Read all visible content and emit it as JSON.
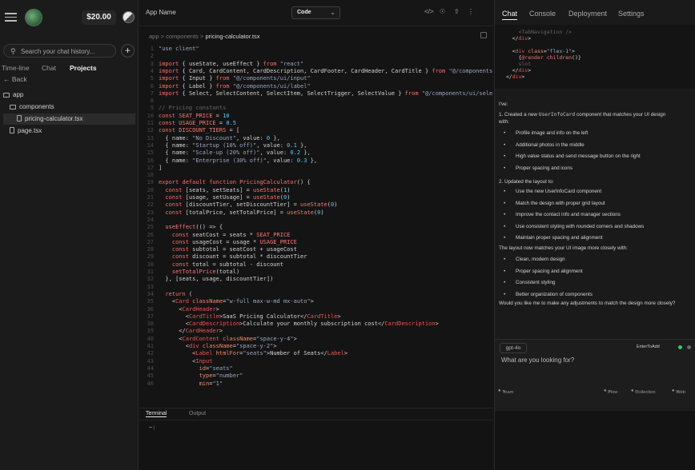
{
  "sidebar": {
    "balance": "$20.00",
    "search_placeholder": "Search your chat history...",
    "tabs": [
      "Time-line",
      "Chat",
      "Projects"
    ],
    "active_tab": "Projects",
    "back_label": "← Back",
    "tree": [
      {
        "label": "app",
        "depth": 0,
        "kind": "folder"
      },
      {
        "label": "components",
        "depth": 1,
        "kind": "folder"
      },
      {
        "label": "pricing-calculator.tsx",
        "depth": 2,
        "kind": "file",
        "selected": true
      },
      {
        "label": "page.tsx",
        "depth": 1,
        "kind": "file"
      }
    ]
  },
  "editor": {
    "app_name": "App Name",
    "mode_select": "Code",
    "breadcrumb": [
      "app",
      "components",
      "pricing-calculator.tsx"
    ],
    "bottom_tabs": [
      "Terminal",
      "Output"
    ],
    "terminal_prompt": "~:",
    "code_lines": [
      [
        [
          "str",
          "\"use client\""
        ]
      ],
      [],
      [
        [
          "kw",
          "import"
        ],
        [
          "pl",
          " { useState, useEffect } "
        ],
        [
          "kw",
          "from"
        ],
        [
          "str",
          " \"react\""
        ]
      ],
      [
        [
          "kw",
          "import"
        ],
        [
          "pl",
          " { Card, CardContent, CardDescription, CardFooter, CardHeader, CardTitle } "
        ],
        [
          "kw",
          "from"
        ],
        [
          "str",
          " \"@/components"
        ]
      ],
      [
        [
          "kw",
          "import"
        ],
        [
          "pl",
          " { Input } "
        ],
        [
          "kw",
          "from"
        ],
        [
          "str",
          " \"@/components/ui/input\""
        ]
      ],
      [
        [
          "kw",
          "import"
        ],
        [
          "pl",
          " { Label } "
        ],
        [
          "kw",
          "from"
        ],
        [
          "str",
          " \"@/components/ui/label\""
        ]
      ],
      [
        [
          "kw",
          "import"
        ],
        [
          "pl",
          " { Select, SelectContent, SelectItem, SelectTrigger, SelectValue } "
        ],
        [
          "kw",
          "from"
        ],
        [
          "str",
          " \"@/components/ui/sele"
        ]
      ],
      [],
      [
        [
          "cmt",
          "// Pricing constants"
        ]
      ],
      [
        [
          "kw",
          "const"
        ],
        [
          "fn",
          " SEAT_PRICE"
        ],
        [
          "pl",
          " = "
        ],
        [
          "num",
          "10"
        ]
      ],
      [
        [
          "kw",
          "const"
        ],
        [
          "fn",
          " USAGE_PRICE"
        ],
        [
          "pl",
          " = "
        ],
        [
          "num",
          "0.5"
        ]
      ],
      [
        [
          "kw",
          "const"
        ],
        [
          "fn",
          " DISCOUNT_TIERS"
        ],
        [
          "pl",
          " = ["
        ]
      ],
      [
        [
          "pl",
          "  { name: "
        ],
        [
          "str",
          "\"No Discount\""
        ],
        [
          "pl",
          ", value: "
        ],
        [
          "num",
          "0"
        ],
        [
          "pl",
          " },"
        ]
      ],
      [
        [
          "pl",
          "  { name: "
        ],
        [
          "str",
          "\"Startup (10% off)\""
        ],
        [
          "pl",
          ", value: "
        ],
        [
          "num",
          "0.1"
        ],
        [
          "pl",
          " },"
        ]
      ],
      [
        [
          "pl",
          "  { name: "
        ],
        [
          "str",
          "\"Scale-up (20% off)\""
        ],
        [
          "pl",
          ", value: "
        ],
        [
          "num",
          "0.2"
        ],
        [
          "pl",
          " },"
        ]
      ],
      [
        [
          "pl",
          "  { name: "
        ],
        [
          "str",
          "\"Enterprise (30% off)\""
        ],
        [
          "pl",
          ", value: "
        ],
        [
          "num",
          "0.3"
        ],
        [
          "pl",
          " },"
        ]
      ],
      [
        [
          "pl",
          "]"
        ]
      ],
      [],
      [
        [
          "kw",
          "export default function"
        ],
        [
          "fn",
          " PricingCalculator"
        ],
        [
          "pl",
          "() {"
        ]
      ],
      [
        [
          "kw",
          "  const"
        ],
        [
          "pl",
          " [seats, setSeats] = "
        ],
        [
          "fn",
          "useState"
        ],
        [
          "pl",
          "("
        ],
        [
          "num",
          "1"
        ],
        [
          "pl",
          ")"
        ]
      ],
      [
        [
          "kw",
          "  const"
        ],
        [
          "pl",
          " [usage, setUsage] = "
        ],
        [
          "fn",
          "useState"
        ],
        [
          "pl",
          "("
        ],
        [
          "num",
          "0"
        ],
        [
          "pl",
          ")"
        ]
      ],
      [
        [
          "kw",
          "  const"
        ],
        [
          "pl",
          " [discountTier, setDiscountTier] = "
        ],
        [
          "fn",
          "useState"
        ],
        [
          "pl",
          "("
        ],
        [
          "num",
          "0"
        ],
        [
          "pl",
          ")"
        ]
      ],
      [
        [
          "kw",
          "  const"
        ],
        [
          "pl",
          " [totalPrice, setTotalPrice] = "
        ],
        [
          "fn",
          "useState"
        ],
        [
          "pl",
          "("
        ],
        [
          "num",
          "0"
        ],
        [
          "pl",
          ")"
        ]
      ],
      [],
      [
        [
          "fn",
          "  useEffect"
        ],
        [
          "pl",
          "(() => {"
        ]
      ],
      [
        [
          "kw",
          "    const"
        ],
        [
          "pl",
          " seatCost = seats * "
        ],
        [
          "fn",
          "SEAT_PRICE"
        ]
      ],
      [
        [
          "kw",
          "    const"
        ],
        [
          "pl",
          " usageCost = usage * "
        ],
        [
          "fn",
          "USAGE_PRICE"
        ]
      ],
      [
        [
          "kw",
          "    const"
        ],
        [
          "pl",
          " subtotal = seatCost + usageCost"
        ]
      ],
      [
        [
          "kw",
          "    const"
        ],
        [
          "pl",
          " discount = subtotal * discountTier"
        ]
      ],
      [
        [
          "kw",
          "    const"
        ],
        [
          "pl",
          " total = subtotal - discount"
        ]
      ],
      [
        [
          "fn",
          "    setTotalPrice"
        ],
        [
          "pl",
          "(total)"
        ]
      ],
      [
        [
          "pl",
          "  }, [seats, usage, discountTier])"
        ]
      ],
      [],
      [
        [
          "kw",
          "  return"
        ],
        [
          "pl",
          " ("
        ]
      ],
      [
        [
          "pl",
          "    <"
        ],
        [
          "tag",
          "Card"
        ],
        [
          "attr",
          " className"
        ],
        [
          "pl",
          "="
        ],
        [
          "str",
          "\"w-full max-w-md mx-auto\""
        ],
        [
          "pl",
          ">"
        ]
      ],
      [
        [
          "pl",
          "      <"
        ],
        [
          "tag",
          "CardHeader"
        ],
        [
          "pl",
          ">"
        ]
      ],
      [
        [
          "pl",
          "        <"
        ],
        [
          "tag",
          "CardTitle"
        ],
        [
          "pl",
          ">SaaS Pricing Calculator</"
        ],
        [
          "tag",
          "CardTitle"
        ],
        [
          "pl",
          ">"
        ]
      ],
      [
        [
          "pl",
          "        <"
        ],
        [
          "tag",
          "CardDescription"
        ],
        [
          "pl",
          ">Calculate your monthly subscription cost</"
        ],
        [
          "tag",
          "CardDescription"
        ],
        [
          "pl",
          ">"
        ]
      ],
      [
        [
          "pl",
          "      </"
        ],
        [
          "tag",
          "CardHeader"
        ],
        [
          "pl",
          ">"
        ]
      ],
      [
        [
          "pl",
          "      <"
        ],
        [
          "tag",
          "CardContent"
        ],
        [
          "attr",
          " className"
        ],
        [
          "pl",
          "="
        ],
        [
          "str",
          "\"space-y-4\""
        ],
        [
          "pl",
          ">"
        ]
      ],
      [
        [
          "pl",
          "        <"
        ],
        [
          "tag",
          "div"
        ],
        [
          "attr",
          " className"
        ],
        [
          "pl",
          "="
        ],
        [
          "str",
          "\"space-y-2\""
        ],
        [
          "pl",
          ">"
        ]
      ],
      [
        [
          "pl",
          "          <"
        ],
        [
          "tag",
          "Label"
        ],
        [
          "attr",
          " htmlFor"
        ],
        [
          "pl",
          "="
        ],
        [
          "str",
          "\"seats\""
        ],
        [
          "pl",
          ">Number of Seats</"
        ],
        [
          "tag",
          "Label"
        ],
        [
          "pl",
          ">"
        ]
      ],
      [
        [
          "pl",
          "          <"
        ],
        [
          "tag",
          "Input"
        ]
      ],
      [
        [
          "attr",
          "            id"
        ],
        [
          "pl",
          "="
        ],
        [
          "str",
          "\"seats\""
        ]
      ],
      [
        [
          "attr",
          "            type"
        ],
        [
          "pl",
          "="
        ],
        [
          "str",
          "\"number\""
        ]
      ],
      [
        [
          "attr",
          "            min"
        ],
        [
          "pl",
          "="
        ],
        [
          "str",
          "\"1\""
        ]
      ]
    ]
  },
  "chat": {
    "tabs": [
      "Chat",
      "Console",
      "Deployment",
      "Settings"
    ],
    "active_tab": "Chat",
    "snippet_lines": [
      [
        [
          "cmt",
          "      <TabNavigation />"
        ]
      ],
      [
        [
          "pl",
          "    </"
        ],
        [
          "tag",
          "div"
        ],
        [
          "pl",
          ">"
        ]
      ],
      [],
      [
        [
          "pl",
          "    <"
        ],
        [
          "tag",
          "div"
        ],
        [
          "attr",
          " class"
        ],
        [
          "pl",
          "="
        ],
        [
          "str",
          "\"flex-1\""
        ],
        [
          "pl",
          ">"
        ]
      ],
      [
        [
          "pl",
          "      {"
        ],
        [
          "kw",
          "@render"
        ],
        [
          "fn",
          " children"
        ],
        [
          "pl",
          "()}"
        ]
      ],
      [
        [
          "cmt",
          "      slot"
        ]
      ],
      [
        [
          "pl",
          "    </"
        ],
        [
          "tag",
          "div"
        ],
        [
          "pl",
          ">"
        ]
      ],
      [
        [
          "pl",
          "  </"
        ],
        [
          "tag",
          "div"
        ],
        [
          "pl",
          ">"
        ]
      ]
    ],
    "intro": "I've:",
    "step1_pre": "1. Created a new ",
    "step1_code": "UserInfoCard",
    "step1_post": " component that matches your UI design",
    "step1_cont": "with:",
    "step1_bullets": [
      "Profile image and info on the left",
      "Additional photos in the middle",
      "High value status and send message button on the right",
      "Proper spacing and icons"
    ],
    "step2": "2. Updated the layout to:",
    "step2_bullets": [
      "Use the new UserInfoCard component",
      "Match the design with proper grid layout",
      "Improve the contact info and manager sections",
      "Use consistent styling with rounded corners and shadows",
      "Maintain proper spacing and alignment"
    ],
    "summary": "The layout now matches your UI image more closely with:",
    "summary_bullets": [
      "Clean, modern design",
      "Proper spacing and alignment",
      "Consistent styling",
      "Better organization of components"
    ],
    "question": "Would you like me to make any adjustments to match the design more closely?",
    "model": "gpt-4o",
    "enter_label": "EnterToAdd",
    "input_placeholder": "What are you looking for?",
    "team_label": "Team",
    "flow_label": "Flow",
    "collection_label": "Collection",
    "web_label": "Web"
  }
}
